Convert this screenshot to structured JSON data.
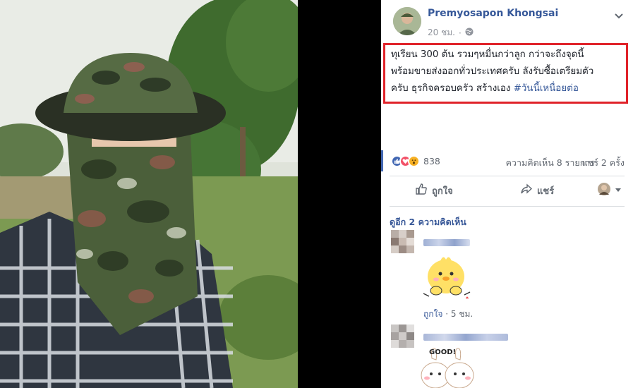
{
  "post": {
    "author": "Premyosapon Khongsai",
    "time": "20 ชม.",
    "separator": "·",
    "text_part1": "ทุเรียน 300 ต้น รวมๆหมื่นกว่าลูก กว่าจะถึงจุดนี้",
    "text_part2": "พร้อมขายส่งออกทั่วประเทศครับ ลังรับซื้อเตรียมตัว",
    "text_part3": "ครับ ธุรกิจครอบครัว สร้างเอง ",
    "hashtag": "#วันนี้เหนื่อยต่อ"
  },
  "stats": {
    "reaction_count": "838",
    "comments": "ความคิดเห็น 8 รายการ",
    "shares": "แชร์ 2 ครั้ง"
  },
  "actions": {
    "like": "ถูกใจ",
    "share": "แชร์"
  },
  "comments_section": {
    "view_more": "ดูอีก 2 ความคิดเห็น",
    "comment1": {
      "like_label": "ถูกใจ",
      "sep": " · ",
      "time": "5 ชม."
    },
    "sticker2_text": "GOOD!"
  },
  "colors": {
    "link_blue": "#365899",
    "highlight_red": "#e0232a",
    "like_blue": "#4267b2",
    "love_red": "#f25268",
    "wow_yellow": "#f7b125"
  },
  "icons": [
    "globe-icon",
    "chevron-down-icon",
    "like-reaction-icon",
    "love-reaction-icon",
    "wow-reaction-icon",
    "thumbs-up-icon",
    "share-arrow-icon",
    "caret-down-icon"
  ]
}
